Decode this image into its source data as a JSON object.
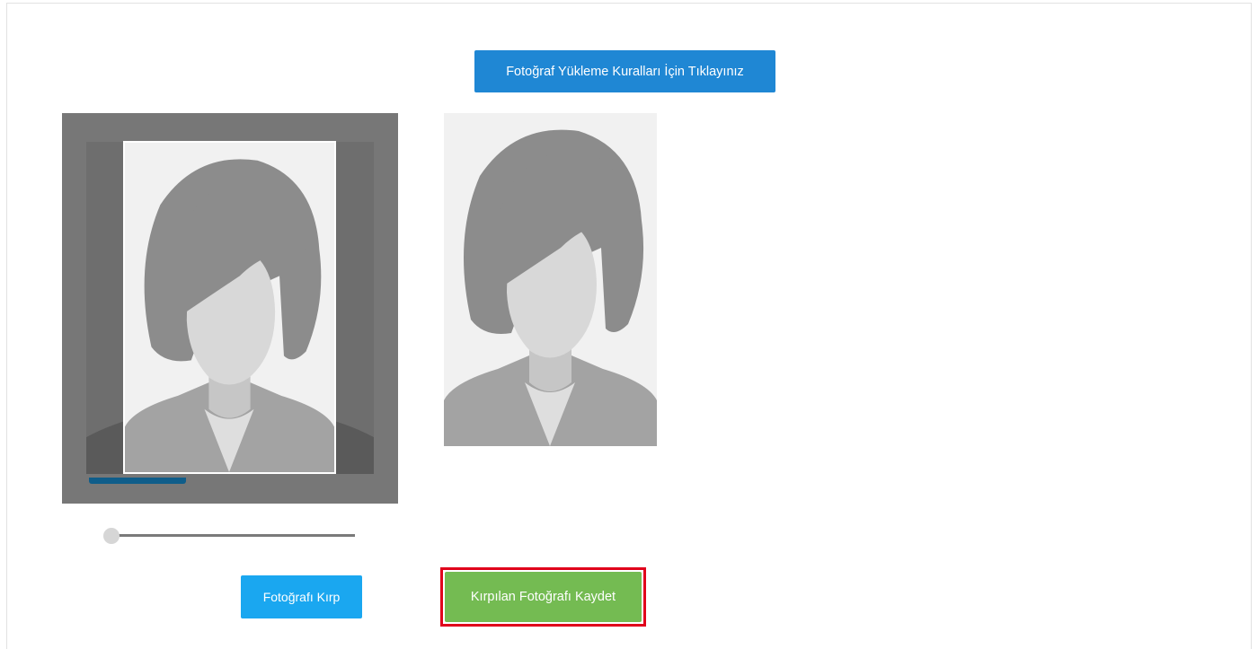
{
  "header": {
    "rules_button_label": "Fotoğraf Yükleme Kuralları İçin Tıklayınız"
  },
  "cropper": {
    "image_icon": "female-avatar-placeholder-icon",
    "zoom_level": 0.0
  },
  "preview": {
    "image_icon": "female-avatar-placeholder-icon"
  },
  "actions": {
    "crop_button_label": "Fotoğrafı Kırp",
    "save_button_label": "Kırpılan Fotoğrafı Kaydet"
  },
  "colors": {
    "rules_button": "#1f87d4",
    "crop_button": "#1aa7f0",
    "save_button": "#74bb52",
    "highlight_border": "#e0001b",
    "cropper_background": "#777777"
  }
}
